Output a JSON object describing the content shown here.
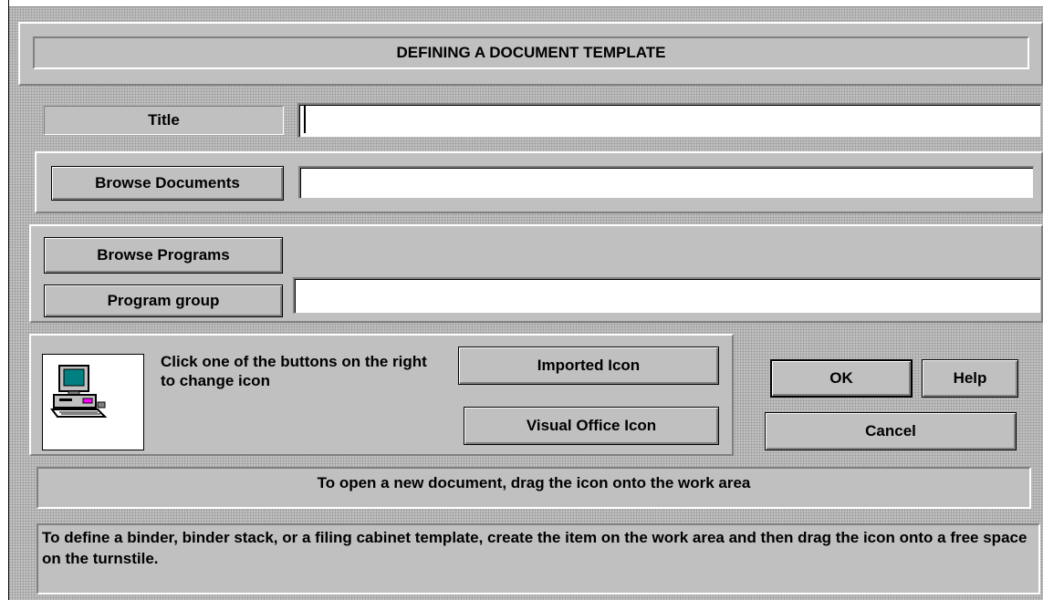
{
  "dialog": {
    "heading": "DEFINING A DOCUMENT TEMPLATE"
  },
  "title_row": {
    "label": "Title",
    "value": ""
  },
  "documents_row": {
    "button_label": "Browse Documents",
    "value": ""
  },
  "programs_row": {
    "browse_button_label": "Browse Programs",
    "group_button_label": "Program group",
    "value": ""
  },
  "icon_section": {
    "icon": "computer-icon",
    "instruction": "Click one of the buttons on the right to change icon",
    "imported_button_label": "Imported Icon",
    "visual_office_button_label": "Visual Office Icon"
  },
  "actions": {
    "ok_label": "OK",
    "help_label": "Help",
    "cancel_label": "Cancel"
  },
  "info": {
    "open_hint": "To open a new document, drag the icon onto the work area",
    "define_hint": "To define a binder, binder stack, or a filing cabinet template, create the item on the work area and then drag the icon onto a free space on the turnstile."
  },
  "colors": {
    "face": "#c0c0c0",
    "shadow": "#808080",
    "highlight": "#ffffff",
    "field": "#ffffff"
  }
}
